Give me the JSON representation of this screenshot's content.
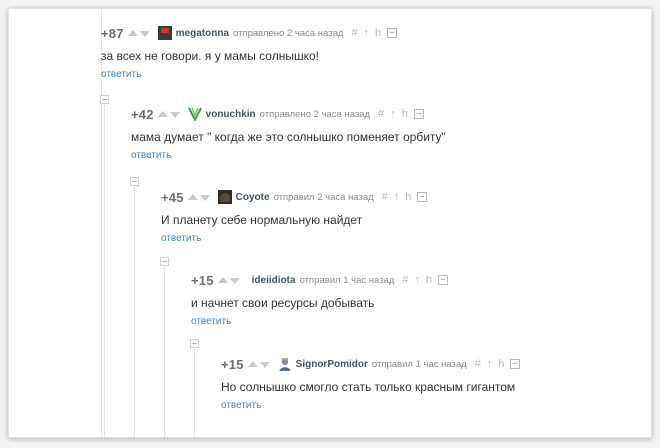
{
  "comments": [
    {
      "score": "+87",
      "user": "megatonna",
      "sent": "отправлено 2 часа назад",
      "text": "за всех не говори. я  у мамы солнышко!",
      "reply": "ответить",
      "avatar": "dark-square-avatar"
    },
    {
      "score": "+42",
      "user": "vonuchkin",
      "sent": "отправлено 2 часа назад",
      "text": "мама думает \" когда же это солнышко поменяет орбиту\"",
      "reply": "ответить",
      "avatar": "green-leaf-avatar"
    },
    {
      "score": "+45",
      "user": "Coyote",
      "sent": "отправил 2 часа назад",
      "text": "И планету себе нормальную найдет",
      "reply": "ответить",
      "avatar": "coyote-photo-avatar"
    },
    {
      "score": "+15",
      "user": "ideiidiota",
      "sent": "отправил 1 час назад",
      "text": "и начнет свои ресурсы добывать",
      "reply": "ответить",
      "avatar": "none"
    },
    {
      "score": "+15",
      "user": "SignorPomidor",
      "sent": "отправил 1 час назад",
      "text": "Но солнышко смогло стать только красным гигантом",
      "reply": "ответить",
      "avatar": "person-avatar"
    }
  ],
  "tools": {
    "hash": "#",
    "up": "↑",
    "h": "h"
  },
  "colors": {
    "link": "#4a7fb3",
    "username": "#445566",
    "meta": "#8a8a8a",
    "score": "#6f6f6f"
  }
}
